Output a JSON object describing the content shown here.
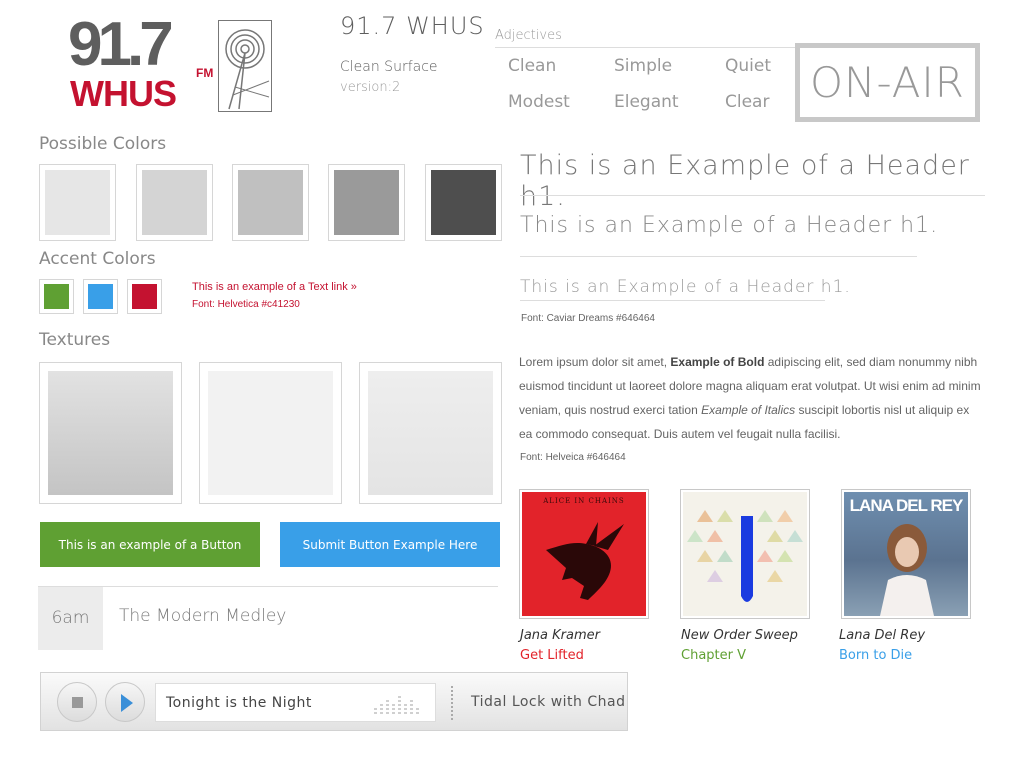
{
  "logo": {
    "number": "91.7",
    "fm": "FM",
    "call": "WHUS"
  },
  "brand": {
    "title": "91.7 WHUS",
    "subtitle": "Clean Surface",
    "version": "version:2"
  },
  "adjectives": {
    "label": "Adjectives",
    "words": [
      "Clean",
      "Simple",
      "Quiet",
      "Modest",
      "Elegant",
      "Clear"
    ]
  },
  "onair": "ON-AIR",
  "colors": {
    "label": "Possible Colors",
    "swatches": [
      "#e6e6e6",
      "#d4d4d4",
      "#c0c0c0",
      "#9a9a9a",
      "#4e4e4e"
    ]
  },
  "accents": {
    "label": "Accent Colors",
    "swatches": [
      "#5fa033",
      "#399fe8",
      "#c41230"
    ],
    "link_text": "This is an example of a Text link »",
    "font_note": "Font: Helvetica  #c41230"
  },
  "textures": {
    "label": "Textures"
  },
  "buttons": {
    "primary": "This is an example of a Button",
    "submit": "Submit Button Example Here",
    "primary_color": "#5fa033",
    "submit_color": "#399fe8"
  },
  "headers": {
    "h1_large": "This is an Example of a Header h1.",
    "h1_medium": "This is an Example of a Header h1.",
    "h1_small": "This is an Example of a Header h1.",
    "font_note": "Font: Caviar Dreams #646464"
  },
  "body_text": {
    "p1": "Lorem ipsum dolor sit amet, ",
    "bold": "Example of Bold",
    "p2": " adipiscing elit, sed diam nonummy nibh euismod tincidunt ut laoreet dolore magna aliquam erat volutpat. Ut wisi enim ad minim veniam, quis nostrud exerci tation ",
    "italic": "Example of Italics",
    "p3": " suscipit lobortis nisl ut aliquip ex ea commodo consequat. Duis autem vel feugait nulla facilisi.",
    "font_note": "Font: Helveica    #646464"
  },
  "albums": [
    {
      "artist": "Jana Kramer",
      "title": "Get Lifted",
      "color": "#c41230",
      "cover_text": "ALICE IN CHAINS"
    },
    {
      "artist": "New Order Sweep",
      "title": "Chapter V",
      "color": "#5fa033",
      "cover_text": ""
    },
    {
      "artist": "Lana Del Rey",
      "title": "Born to Die",
      "color": "#399fe8",
      "cover_text": "LANA DEL REY"
    }
  ],
  "schedule": {
    "time": "6am",
    "show": "The Modern Medley"
  },
  "player": {
    "now_playing": "Tonight is the Night",
    "dj": "Tidal Lock with Chad"
  }
}
